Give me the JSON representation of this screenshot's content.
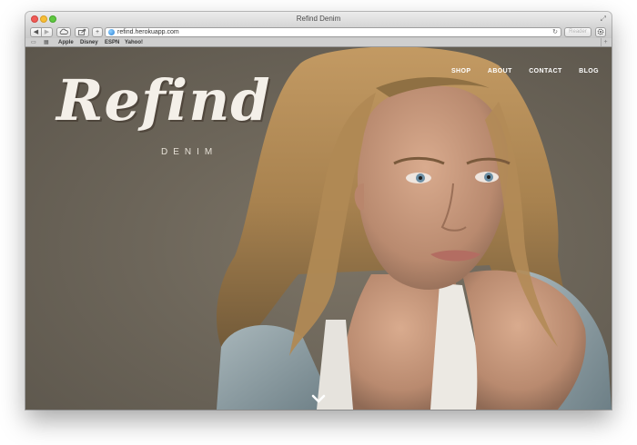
{
  "window": {
    "title": "Refind Denim"
  },
  "toolbar": {
    "back": "◀",
    "forward": "▶",
    "add": "+",
    "url": "refind.herokuapp.com",
    "reload": "↻",
    "reader": "Reader"
  },
  "bookmarks": [
    "Apple",
    "Disney",
    "ESPN",
    "Yahoo!"
  ],
  "site": {
    "brand": "Refind",
    "subtitle": "DENIM",
    "nav": [
      "SHOP",
      "ABOUT",
      "CONTACT",
      "BLOG"
    ]
  },
  "icons": {
    "scroll": "chevron-down-icon",
    "globe": "globe-icon",
    "cloud": "cloud-icon",
    "share": "share-icon",
    "settings": "gear-icon"
  }
}
